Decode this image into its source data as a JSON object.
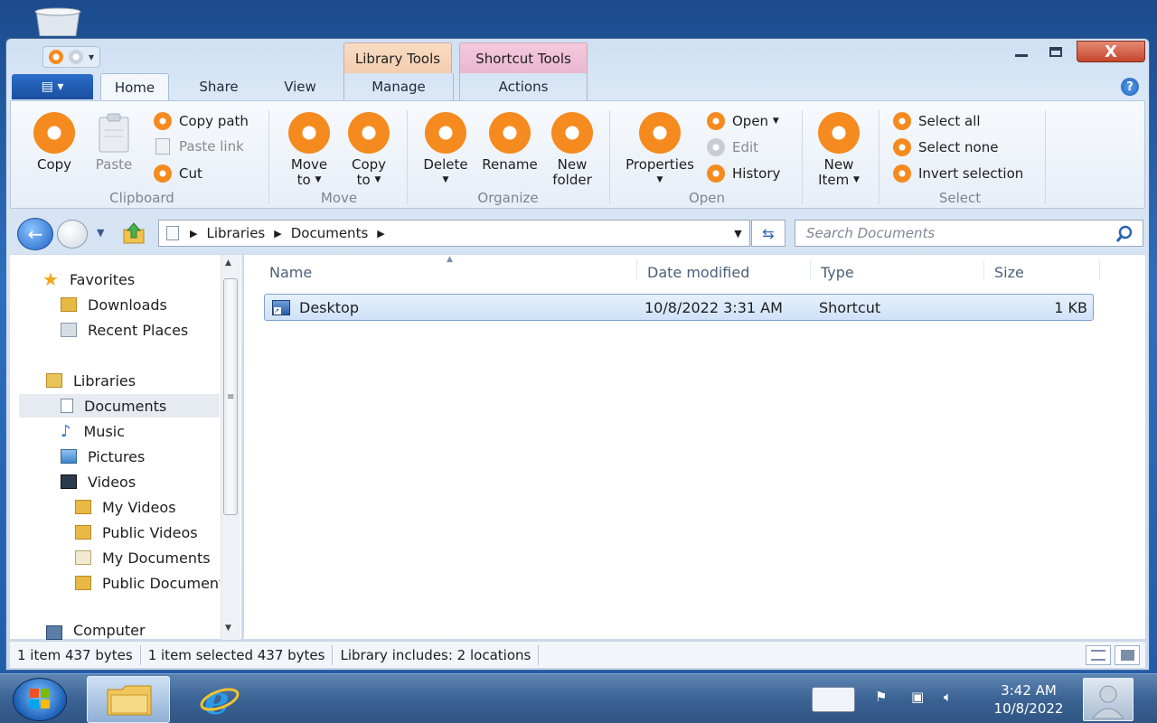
{
  "window": {
    "context_tabs": {
      "library_tools": "Library Tools",
      "shortcut_tools": "Shortcut Tools"
    },
    "close_glyph": "X"
  },
  "tabs": {
    "home": "Home",
    "share": "Share",
    "view": "View",
    "manage": "Manage",
    "actions": "Actions"
  },
  "ribbon": {
    "clipboard": {
      "copy": "Copy",
      "paste": "Paste",
      "copy_path": "Copy path",
      "paste_link": "Paste link",
      "cut": "Cut",
      "label": "Clipboard"
    },
    "move": {
      "move_to": "Move",
      "move_to2": "to",
      "copy_to": "Copy",
      "copy_to2": "to",
      "label": "Move"
    },
    "organize": {
      "delete": "Delete",
      "rename": "Rename",
      "new_folder": "New",
      "new_folder2": "folder",
      "label": "Organize"
    },
    "open": {
      "properties": "Properties",
      "open": "Open",
      "edit": "Edit",
      "history": "History",
      "label": "Open"
    },
    "new": {
      "new_item": "New",
      "new_item2": "Item",
      "label": ""
    },
    "select": {
      "select_all": "Select all",
      "select_none": "Select none",
      "invert": "Invert selection",
      "label": "Select"
    }
  },
  "address": {
    "crumbs": [
      "Libraries",
      "Documents"
    ],
    "search_placeholder": "Search Documents"
  },
  "nav": {
    "favorites": "Favorites",
    "downloads": "Downloads",
    "recent_places": "Recent Places",
    "libraries": "Libraries",
    "documents": "Documents",
    "music": "Music",
    "pictures": "Pictures",
    "videos": "Videos",
    "my_videos": "My Videos",
    "public_videos": "Public Videos",
    "my_documents": "My Documents",
    "public_documents": "Public Documents",
    "computer": "Computer"
  },
  "columns": {
    "name": "Name",
    "date": "Date modified",
    "type": "Type",
    "size": "Size"
  },
  "files": [
    {
      "name": "Desktop",
      "date": "10/8/2022 3:31 AM",
      "type": "Shortcut",
      "size": "1 KB"
    }
  ],
  "status": {
    "items": "1 item 437 bytes",
    "selected": "1 item selected  437 bytes",
    "library": "Library includes:  2 locations"
  },
  "taskbar": {
    "time": "3:42 AM",
    "date": "10/8/2022"
  },
  "colors": {
    "accent_orange": "#f58a1f",
    "selection": "#cfe2f8",
    "taskbar": "#3b6394"
  }
}
